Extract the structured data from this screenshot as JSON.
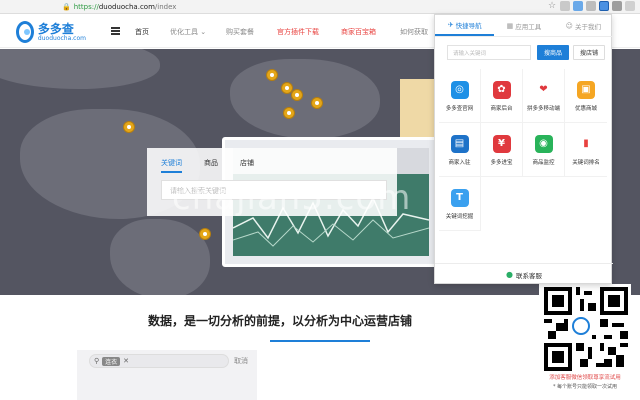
{
  "browser": {
    "url_protocol": "https://",
    "url_host": "duoduocha.com",
    "url_path": "/index"
  },
  "site": {
    "logo_cn": "多多查",
    "logo_en": "duoduocha.com",
    "nav": {
      "home": "首页",
      "optimize": "优化工具 ⌄",
      "buy_ticket": "购买套餐",
      "plugin": "官方插件下载",
      "merchant": "商家百宝箱",
      "get": "如何获取"
    }
  },
  "hero": {
    "tabs": [
      "关键词",
      "商品",
      "店铺"
    ],
    "search_placeholder": "请输入搜索关键词"
  },
  "watermark": "chajian5.com",
  "slogan": "数据，是一切分析的前提，以分析为中心运营店铺",
  "bottom": {
    "tag": "连衣",
    "cancel": "取消"
  },
  "qr": {
    "red_text": "添加客服微信领取尊享流试用",
    "note": "* 每个账号只能领取一次试用"
  },
  "popup": {
    "tabs": [
      {
        "icon": "✈",
        "label": "快捷导航"
      },
      {
        "icon": "▦",
        "label": "应用工具"
      },
      {
        "icon": "☺",
        "label": "关于我们"
      }
    ],
    "input_placeholder": "请输入关键词",
    "btn_search": "搜商品",
    "btn_shop": "搜店铺",
    "apps": [
      {
        "label": "多多查官网",
        "color": "#1e90e6",
        "glyph": "◎"
      },
      {
        "label": "商家后台",
        "color": "#e0393e",
        "glyph": "✿"
      },
      {
        "label": "拼多多移动端",
        "color": "#ffffff",
        "glyph": "❤"
      },
      {
        "label": "优惠商城",
        "color": "#f5a623",
        "glyph": "▣"
      },
      {
        "label": "商家入驻",
        "color": "#1e72c8",
        "glyph": "▤"
      },
      {
        "label": "多多进宝",
        "color": "#e0393e",
        "glyph": "¥"
      },
      {
        "label": "商品监控",
        "color": "#29b35a",
        "glyph": "◉"
      },
      {
        "label": "关键词排名",
        "color": "#ffffff",
        "glyph": "▮"
      },
      {
        "label": "关键词挖掘",
        "color": "#3aa0ef",
        "glyph": "T"
      }
    ],
    "footer": "联系客服"
  }
}
